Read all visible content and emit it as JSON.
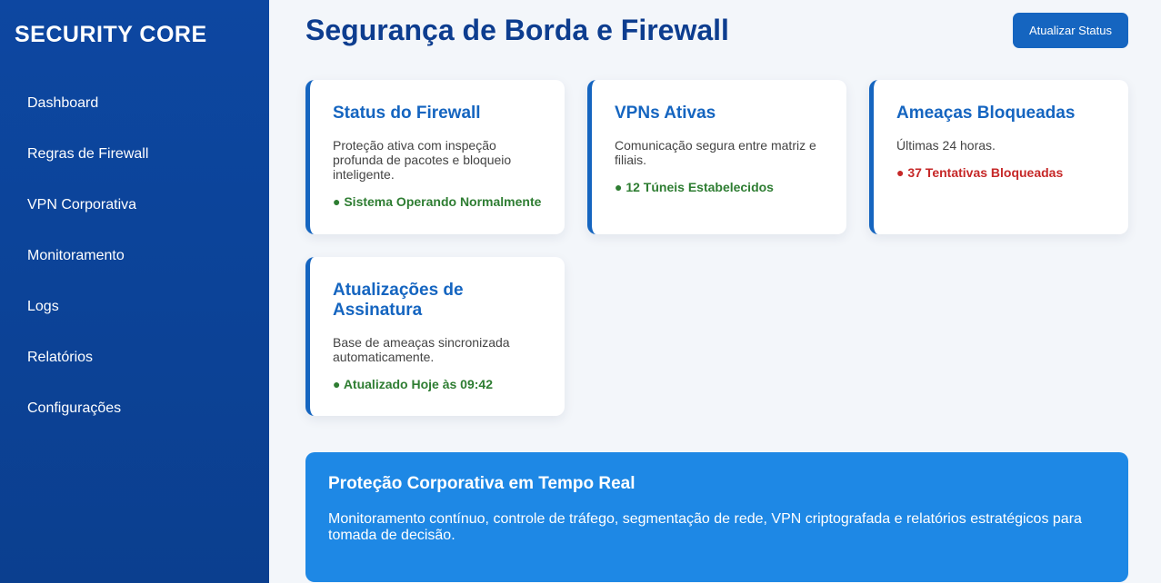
{
  "sidebar": {
    "brand": "SECURITY CORE",
    "items": [
      {
        "label": "Dashboard"
      },
      {
        "label": "Regras de Firewall"
      },
      {
        "label": "VPN Corporativa"
      },
      {
        "label": "Monitoramento"
      },
      {
        "label": "Logs"
      },
      {
        "label": "Relatórios"
      },
      {
        "label": "Configurações"
      }
    ]
  },
  "header": {
    "title": "Segurança de Borda e Firewall",
    "refresh_label": "Atualizar Status"
  },
  "cards": [
    {
      "title": "Status do Firewall",
      "desc": "Proteção ativa com inspeção profunda de pacotes e bloqueio inteligente.",
      "status": "● Sistema Operando Normalmente",
      "status_color": "#2e7d32"
    },
    {
      "title": "VPNs Ativas",
      "desc": "Comunicação segura entre matriz e filiais.",
      "status": "● 12 Túneis Estabelecidos",
      "status_color": "#2e7d32"
    },
    {
      "title": "Ameaças Bloqueadas",
      "desc": "Últimas 24 horas.",
      "status": "● 37 Tentativas Bloqueadas",
      "status_color": "#c62828"
    },
    {
      "title": "Atualizações de Assinatura",
      "desc": "Base de ameaças sincronizada automaticamente.",
      "status": "● Atualizado Hoje às 09:42",
      "status_color": "#2e7d32"
    }
  ],
  "banner": {
    "title": "Proteção Corporativa em Tempo Real",
    "text": "Monitoramento contínuo, controle de tráfego, segmentação de rede, VPN criptografada e relatórios estratégicos para tomada de decisão."
  },
  "colors": {
    "sidebar": "#0d47a1",
    "accent": "#1565c0",
    "banner": "#1e88e5",
    "ok": "#2e7d32",
    "alert": "#c62828"
  }
}
